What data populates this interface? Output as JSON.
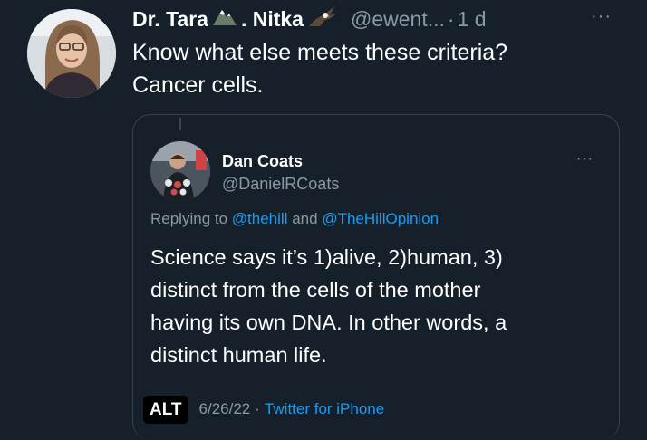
{
  "tweet": {
    "author_name_part1": "Dr. Tara",
    "author_name_part2": ". Nitka",
    "author_emoji_1": "mountain-icon",
    "author_emoji_2": "eagle-icon",
    "handle": "@ewent...",
    "separator": "·",
    "time": "1 d",
    "more": "···",
    "text_lines": [
      "Know what else meets these criteria?",
      "Cancer cells."
    ]
  },
  "quote": {
    "author_name": "Dan Coats",
    "handle": "@DanielRCoats",
    "more": "···",
    "replying_prefix": "Replying to",
    "mention_1": "@thehill",
    "replying_and": "and",
    "mention_2": "@TheHillOpinion",
    "text_lines": [
      "Science says it’s 1)alive, 2)human, 3)",
      "distinct from the cells of the mother",
      "having its own DNA. In other words, a",
      "distinct human life."
    ],
    "alt_badge": "ALT",
    "date": "6/26/22",
    "separator": "·",
    "source": "Twitter for iPhone"
  },
  "colors": {
    "background": "#15202b",
    "text_primary": "#ffffff",
    "text_secondary": "#8b98a5",
    "link": "#1d9bf0",
    "border": "#38444d"
  }
}
